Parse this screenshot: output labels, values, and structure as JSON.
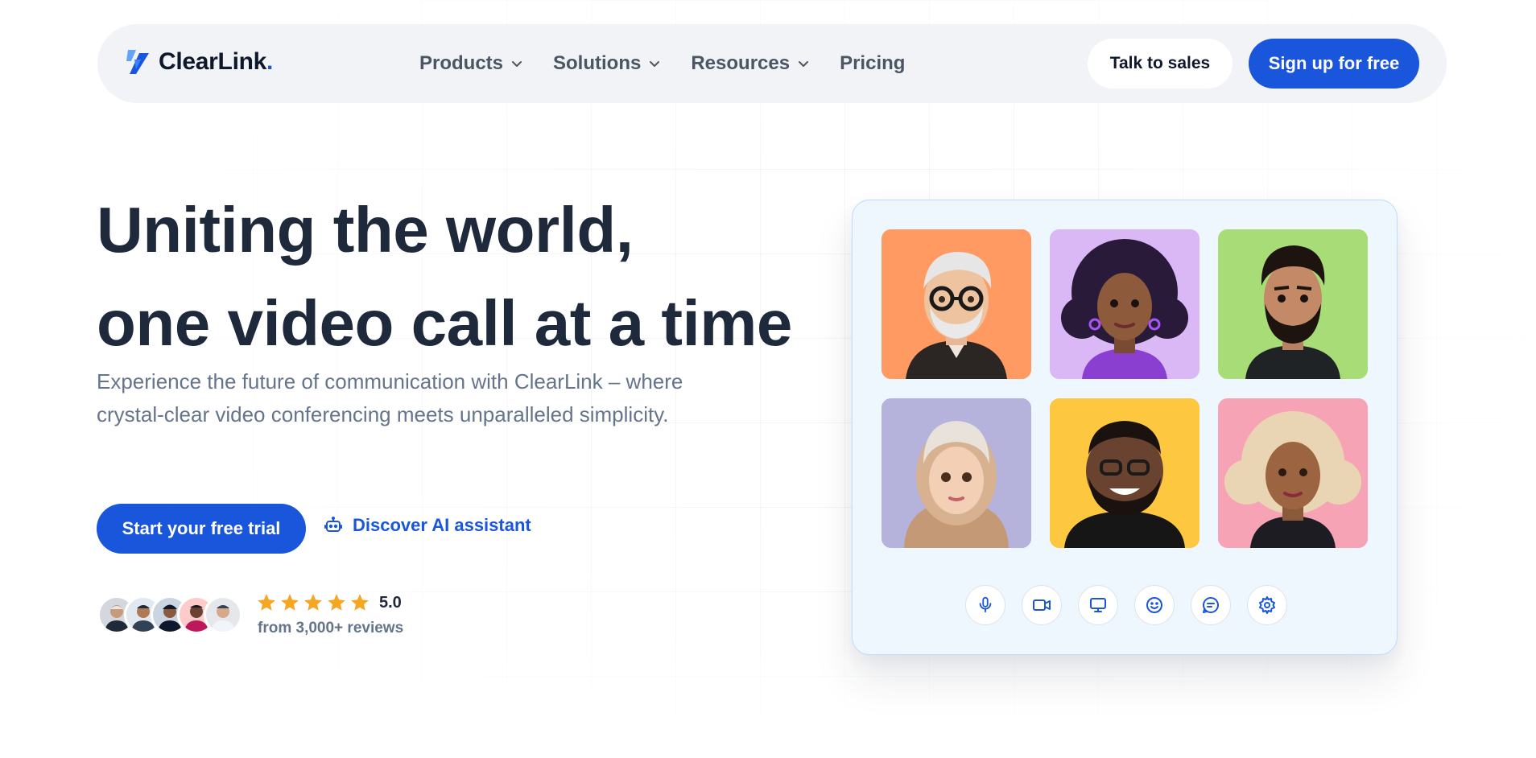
{
  "brand": {
    "name": "ClearLink",
    "dot": ".",
    "accent": "#1a56db"
  },
  "nav": {
    "links": [
      {
        "label": "Products",
        "has_dropdown": true
      },
      {
        "label": "Solutions",
        "has_dropdown": true
      },
      {
        "label": "Resources",
        "has_dropdown": true
      },
      {
        "label": "Pricing",
        "has_dropdown": false
      }
    ],
    "talk_to_sales": "Talk to sales",
    "sign_up": "Sign up for free"
  },
  "hero": {
    "title_line1": "Uniting the world,",
    "title_line2": "one video call at a time",
    "subtitle": "Experience the future of communication with ClearLink – where crystal-clear video conferencing meets unparalleled simplicity.",
    "cta_primary": "Start your free trial",
    "cta_secondary": "Discover AI assistant",
    "cta_secondary_icon": "robot-icon"
  },
  "reviews": {
    "avatar_count": 5,
    "stars": 5,
    "rating": "5.0",
    "count_text": "from 3,000+ reviews",
    "star_color": "#f5a623"
  },
  "call": {
    "tiles": [
      {
        "name": "avatar-older-man-glasses",
        "bg": "#ff9a62"
      },
      {
        "name": "avatar-woman-curly-hair",
        "bg": "#d9b8f5"
      },
      {
        "name": "avatar-bearded-man",
        "bg": "#a8dc76"
      },
      {
        "name": "avatar-woman-hijab",
        "bg": "#b5b3dc"
      },
      {
        "name": "avatar-smiling-man-glasses",
        "bg": "#fdc83f"
      },
      {
        "name": "avatar-woman-blonde-curls",
        "bg": "#f7a3b6"
      }
    ],
    "controls": [
      "microphone-icon",
      "video-camera-icon",
      "screen-share-icon",
      "emoji-icon",
      "chat-icon",
      "settings-icon"
    ]
  }
}
